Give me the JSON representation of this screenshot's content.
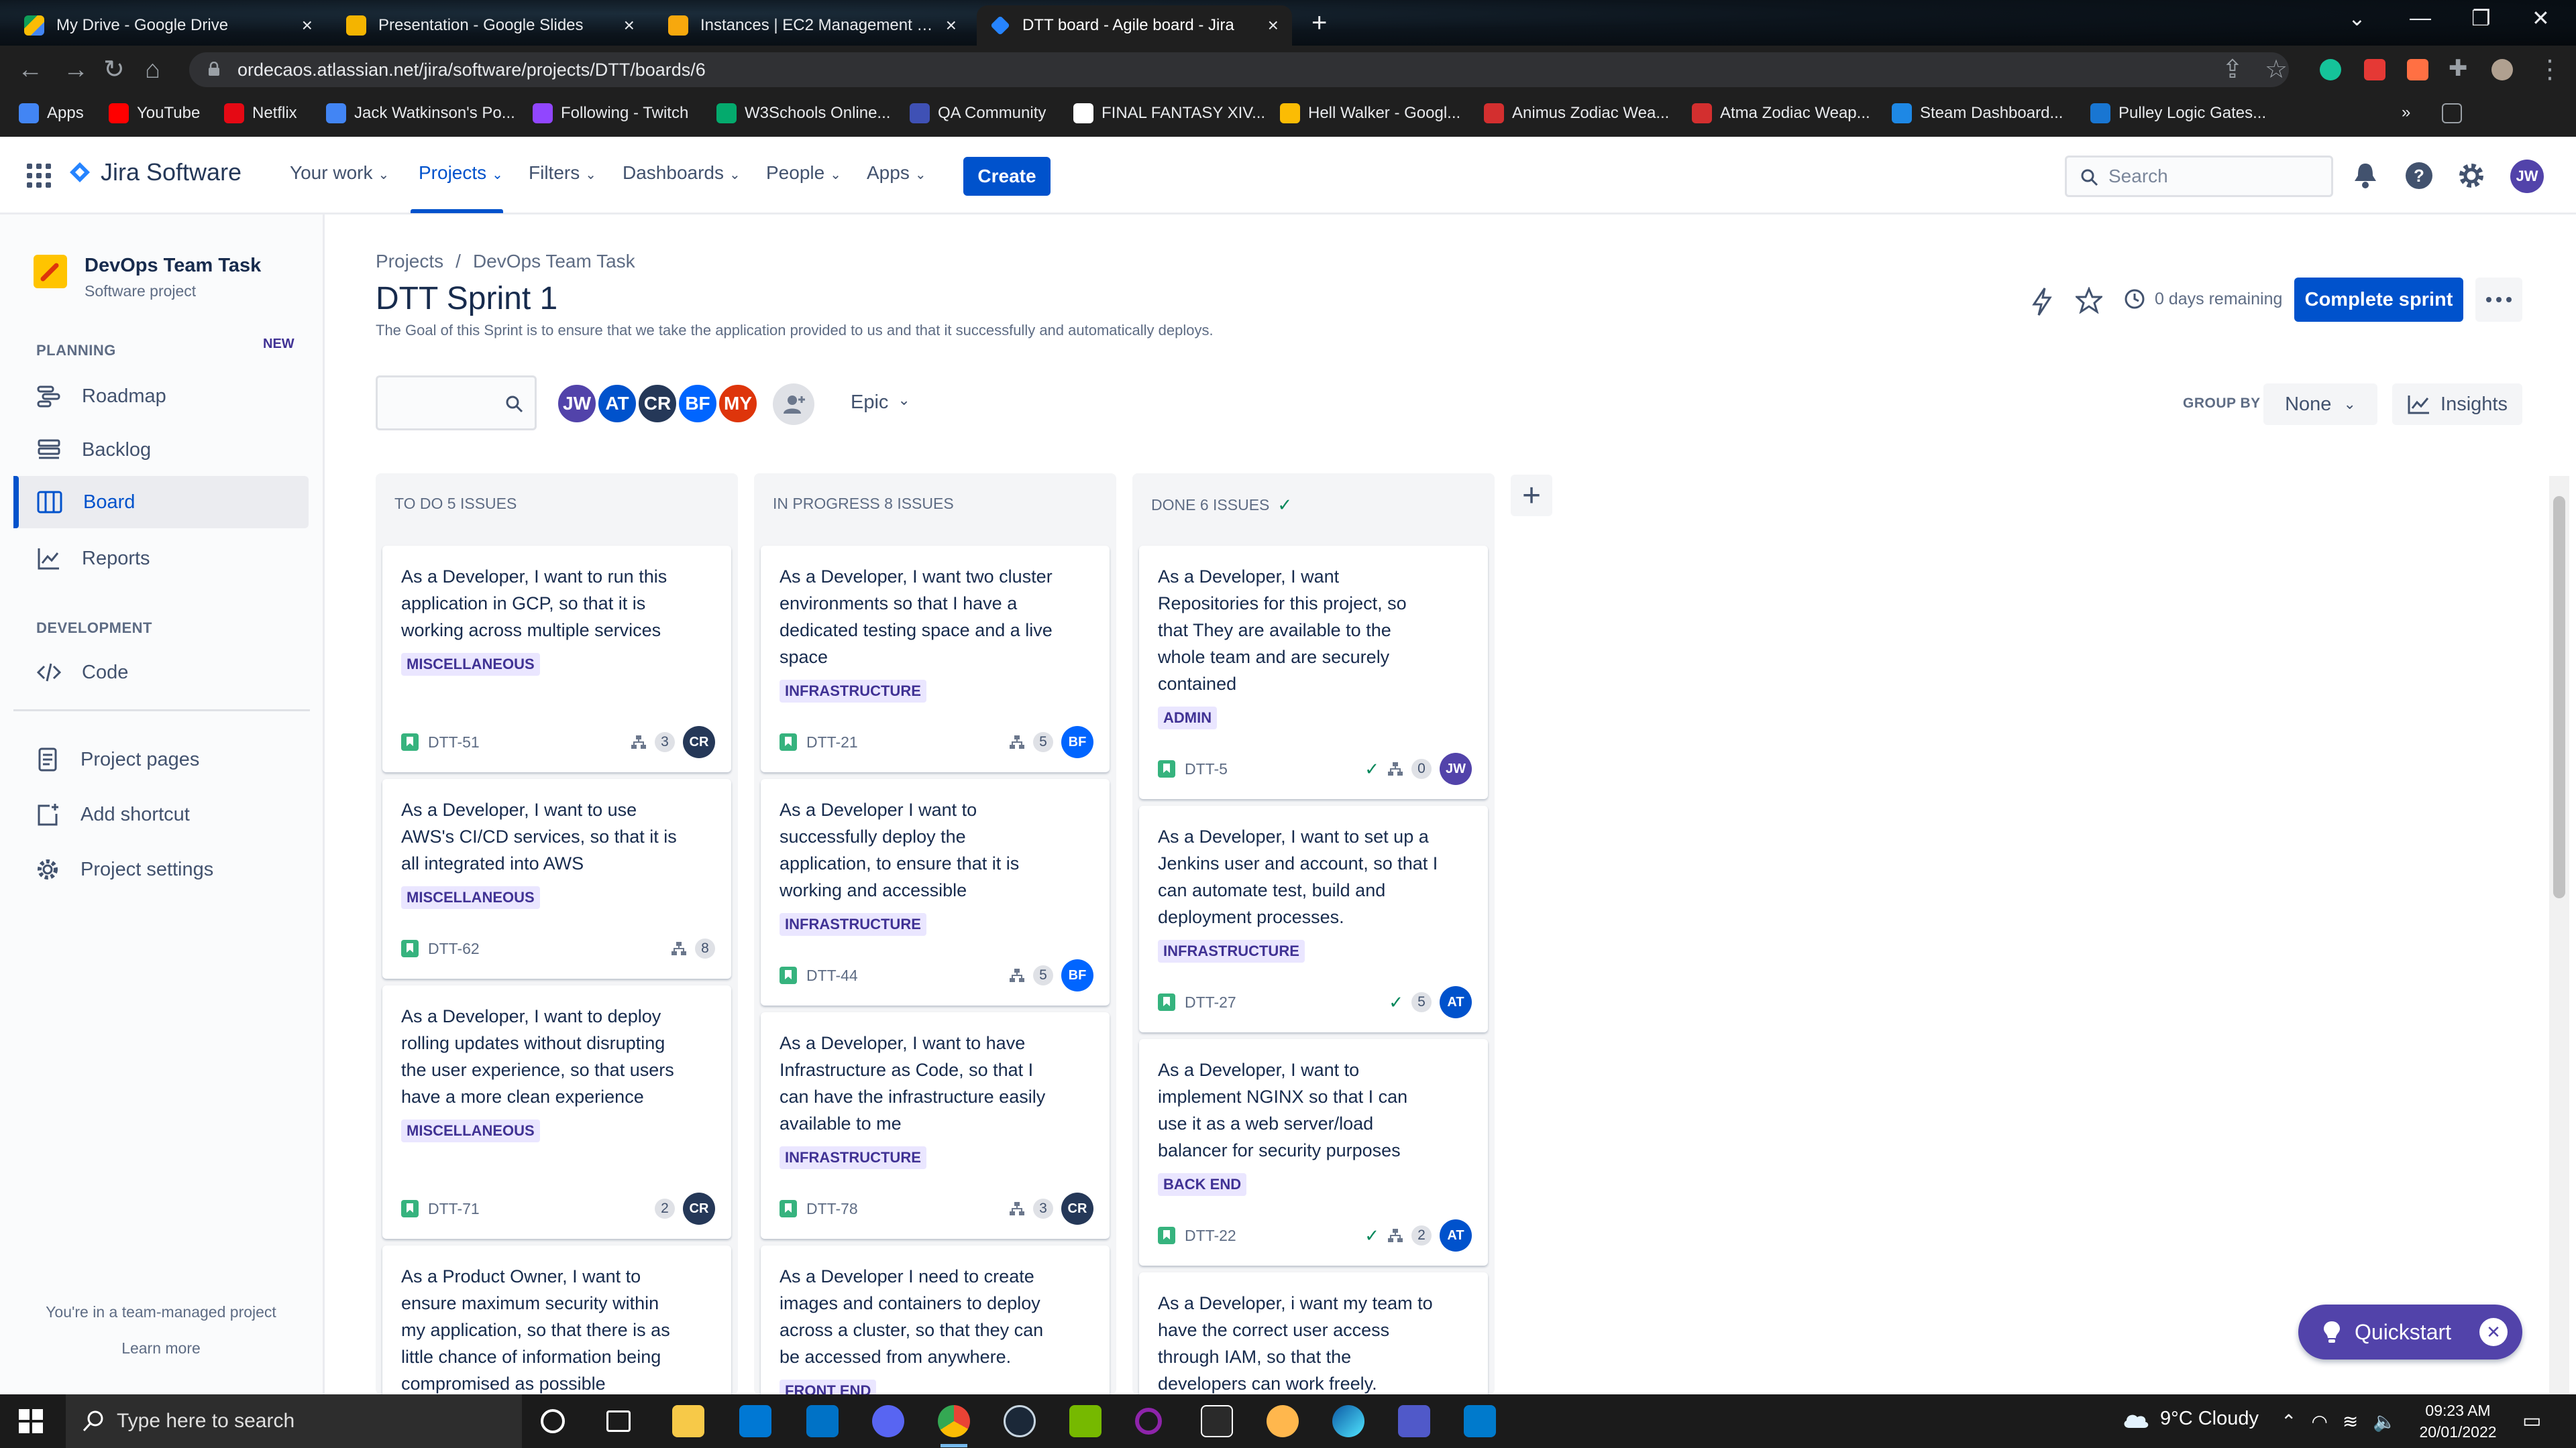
{
  "browser": {
    "tabs": [
      {
        "title": "My Drive - Google Drive",
        "favicon_color": "#fbbc04",
        "active": false
      },
      {
        "title": "Presentation - Google Slides",
        "favicon_color": "#f4b400",
        "active": false
      },
      {
        "title": "Instances | EC2 Management Co",
        "favicon_color": "#f7a80d",
        "active": false
      },
      {
        "title": "DTT board - Agile board - Jira",
        "favicon_color": "#2684ff",
        "active": true
      }
    ],
    "url": "ordecaos.atlassian.net/jira/software/projects/DTT/boards/6",
    "bookmarks": [
      {
        "label": "Apps",
        "color": "#4285f4"
      },
      {
        "label": "YouTube",
        "color": "#ff0000"
      },
      {
        "label": "Netflix",
        "color": "#e50914"
      },
      {
        "label": "Jack Watkinson's Po...",
        "color": "#4285f4"
      },
      {
        "label": "Following - Twitch",
        "color": "#9146ff"
      },
      {
        "label": "W3Schools Online...",
        "color": "#04aa6d"
      },
      {
        "label": "QA Community",
        "color": "#3f51b5"
      },
      {
        "label": "FINAL FANTASY XIV...",
        "color": "#ffffff"
      },
      {
        "label": "Hell Walker - Googl...",
        "color": "#fbbc04"
      },
      {
        "label": "Animus Zodiac Wea...",
        "color": "#d32f2f"
      },
      {
        "label": "Atma Zodiac Weap...",
        "color": "#d32f2f"
      },
      {
        "label": "Steam Dashboard...",
        "color": "#1e88e5"
      },
      {
        "label": "Pulley Logic Gates...",
        "color": "#1976d2"
      }
    ]
  },
  "jira": {
    "product": "Jira Software",
    "nav": [
      {
        "label": "Your work",
        "active": false
      },
      {
        "label": "Projects",
        "active": true
      },
      {
        "label": "Filters",
        "active": false
      },
      {
        "label": "Dashboards",
        "active": false
      },
      {
        "label": "People",
        "active": false
      },
      {
        "label": "Apps",
        "active": false
      }
    ],
    "create_label": "Create",
    "search_placeholder": "Search",
    "user_initials": "JW"
  },
  "sidebar": {
    "project_name": "DevOps Team Task",
    "project_type": "Software project",
    "planning_label": "PLANNING",
    "new_badge": "NEW",
    "planning_items": [
      {
        "label": "Roadmap",
        "icon": "roadmap-icon"
      },
      {
        "label": "Backlog",
        "icon": "backlog-icon"
      },
      {
        "label": "Board",
        "icon": "board-icon",
        "active": true
      },
      {
        "label": "Reports",
        "icon": "reports-icon"
      }
    ],
    "development_label": "DEVELOPMENT",
    "development_items": [
      {
        "label": "Code",
        "icon": "code-icon"
      }
    ],
    "other_items": [
      {
        "label": "Project pages",
        "icon": "pages-icon"
      },
      {
        "label": "Add shortcut",
        "icon": "add-shortcut-icon"
      },
      {
        "label": "Project settings",
        "icon": "settings-icon"
      }
    ],
    "team_managed": "You're in a team-managed project",
    "learn_more": "Learn more"
  },
  "board": {
    "breadcrumb": [
      "Projects",
      "DevOps Team Task"
    ],
    "title": "DTT Sprint 1",
    "goal": "The Goal of this Sprint is to ensure that we take the application provided to us and that it successfully and automatically deploys.",
    "days_remaining": "0 days remaining",
    "complete_sprint_label": "Complete sprint",
    "filter_avatars": [
      {
        "initials": "JW",
        "color": "#5243aa"
      },
      {
        "initials": "AT",
        "color": "#0052cc"
      },
      {
        "initials": "CR",
        "color": "#253858"
      },
      {
        "initials": "BF",
        "color": "#0065ff"
      },
      {
        "initials": "MY",
        "color": "#de350b"
      }
    ],
    "epic_label": "Epic",
    "group_by_label": "GROUP BY",
    "group_by_value": "None",
    "insights_label": "Insights",
    "quickstart_label": "Quickstart",
    "columns": [
      {
        "title": "TO DO 5 ISSUES",
        "cards": [
          {
            "summary": "As a Developer, I want to run this application in GCP, so that it is working across multiple services",
            "epic": "MISCELLANEOUS",
            "key": "DTT-51",
            "done": false,
            "subtasks": true,
            "count": "3",
            "assignee": "CR",
            "assignee_color": "#253858"
          },
          {
            "summary": "As a Developer, I want to use AWS's CI/CD services, so that it is all integrated into AWS",
            "epic": "MISCELLANEOUS",
            "key": "DTT-62",
            "done": false,
            "subtasks": true,
            "count": "8",
            "assignee": "",
            "assignee_color": ""
          },
          {
            "summary": "As a Developer, I want to deploy rolling updates without disrupting the user experience, so that users have a more clean experience",
            "epic": "MISCELLANEOUS",
            "key": "DTT-71",
            "done": false,
            "subtasks": false,
            "count": "2",
            "assignee": "CR",
            "assignee_color": "#253858"
          },
          {
            "summary": "As a Product Owner, I want to ensure maximum security within my application, so that there is as little chance of information being compromised as possible",
            "epic": "",
            "key": "",
            "done": false,
            "subtasks": false,
            "count": "",
            "assignee": "",
            "assignee_color": ""
          }
        ]
      },
      {
        "title": "IN PROGRESS 8 ISSUES",
        "cards": [
          {
            "summary": "As a Developer, I want two cluster environments so that I have a dedicated testing space and a live space",
            "epic": "INFRASTRUCTURE",
            "key": "DTT-21",
            "done": false,
            "subtasks": true,
            "count": "5",
            "assignee": "BF",
            "assignee_color": "#0065ff"
          },
          {
            "summary": "As a Developer I want to successfully deploy the application, to ensure that it is working and accessible",
            "epic": "INFRASTRUCTURE",
            "key": "DTT-44",
            "done": false,
            "subtasks": true,
            "count": "5",
            "assignee": "BF",
            "assignee_color": "#0065ff"
          },
          {
            "summary": "As a Developer, I want to have Infrastructure as Code, so that I can have the infrastructure easily available to me",
            "epic": "INFRASTRUCTURE",
            "key": "DTT-78",
            "done": false,
            "subtasks": true,
            "count": "3",
            "assignee": "CR",
            "assignee_color": "#253858"
          },
          {
            "summary": "As a Developer I need to create images and containers to deploy across a cluster, so that they can be accessed from anywhere.",
            "epic": "FRONT END",
            "key": "",
            "done": false,
            "subtasks": false,
            "count": "",
            "assignee": "",
            "assignee_color": ""
          }
        ]
      },
      {
        "title": "DONE 6 ISSUES",
        "cards": [
          {
            "summary": "As a Developer, I want Repositories for this project, so that They are available to the whole team and are securely contained",
            "epic": "ADMIN",
            "key": "DTT-5",
            "done": true,
            "subtasks": true,
            "count": "0",
            "assignee": "JW",
            "assignee_color": "#5243aa"
          },
          {
            "summary": "As a Developer, I want to set up a Jenkins user and account, so that I can automate test, build and deployment processes.",
            "epic": "INFRASTRUCTURE",
            "key": "DTT-27",
            "done": true,
            "subtasks": false,
            "count": "5",
            "assignee": "AT",
            "assignee_color": "#0052cc"
          },
          {
            "summary": "As a Developer, I want to implement NGINX so that I can use it as a web server/load balancer for security purposes",
            "epic": "BACK END",
            "key": "DTT-22",
            "done": true,
            "subtasks": true,
            "count": "2",
            "assignee": "AT",
            "assignee_color": "#0052cc"
          },
          {
            "summary": "As a Developer, i want my team to have the correct user access through IAM, so that the developers can work freely.",
            "epic": "",
            "key": "",
            "done": true,
            "subtasks": false,
            "count": "",
            "assignee": "",
            "assignee_color": ""
          }
        ]
      }
    ]
  },
  "taskbar": {
    "search_placeholder": "Type here to search",
    "weather": "9°C  Cloudy",
    "time": "09:23 AM",
    "date": "20/01/2022"
  }
}
